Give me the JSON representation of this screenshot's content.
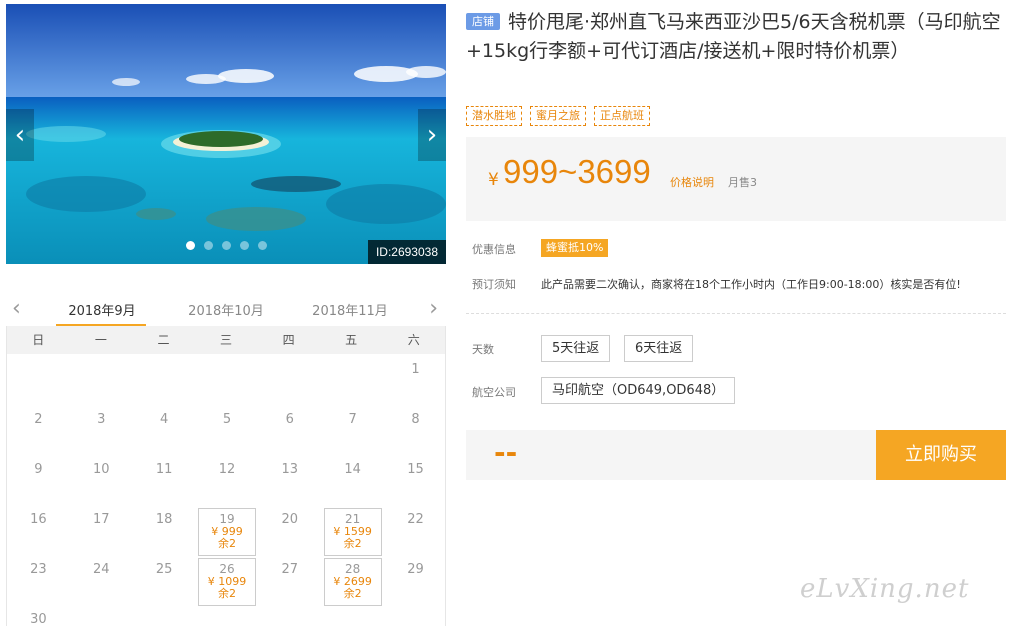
{
  "gallery": {
    "image_id": "ID:2693038",
    "prev_glyph": "‹",
    "next_glyph": "›",
    "dot_count": 5,
    "active_dot": 0
  },
  "calendar": {
    "prev_glyph": "‹",
    "next_glyph": "›",
    "months": [
      "2018年9月",
      "2018年10月",
      "2018年11月"
    ],
    "active_month": 0,
    "weekdays": [
      "日",
      "一",
      "二",
      "三",
      "四",
      "五",
      "六"
    ],
    "first_weekday": 6,
    "days_in_month": 30,
    "prices": {
      "19": {
        "price": "¥ 999",
        "stock": "余2"
      },
      "21": {
        "price": "¥ 1599",
        "stock": "余2"
      },
      "26": {
        "price": "¥ 1099",
        "stock": "余2"
      },
      "28": {
        "price": "¥ 2699",
        "stock": "余2"
      }
    }
  },
  "product": {
    "shop_badge": "店铺",
    "title": "特价甩尾·郑州直飞马来西亚沙巴5/6天含税机票（马印航空+15kg行李额+可代订酒店/接送机+限时特价机票）",
    "tags": [
      "潜水胜地",
      "蜜月之旅",
      "正点航班"
    ],
    "price_currency": "¥",
    "price_range": "999~3699",
    "price_note": "价格说明",
    "sold": "月售3",
    "promo_label": "优惠信息",
    "promo_badge": "蜂蜜抵10%",
    "notice_label": "预订须知",
    "notice_text": "此产品需要二次确认，商家将在18个工作小时内（工作日9:00-18:00）核实是否有位!",
    "days_label": "天数",
    "days_options": [
      "5天往返",
      "6天往返"
    ],
    "airline_label": "航空公司",
    "airline_option": "马印航空（OD649,OD648）",
    "selected_price": "--",
    "buy_label": "立即购买"
  },
  "watermark": "eLvXing.net",
  "colors": {
    "accent": "#f5a623",
    "price": "#e8860b",
    "badge": "#6c9be6"
  }
}
